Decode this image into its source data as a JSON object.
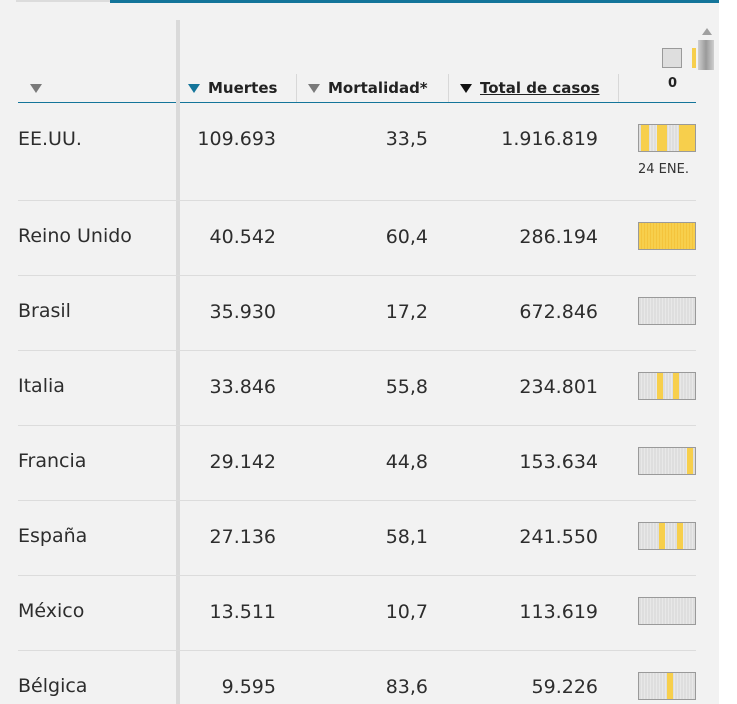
{
  "table": {
    "headers": {
      "country": "",
      "deaths": "Muertes",
      "mortality": "Mortalidad*",
      "cases": "Total de casos"
    },
    "sparkline_axis_label": "0",
    "sparkline_date_label": "24 ENE.",
    "colors": {
      "accent": "#14759a",
      "highlight": "#f7cf4c",
      "background": "#f2f2f2"
    },
    "rows": [
      {
        "country": "EE.UU.",
        "deaths": "109.693",
        "mortality": "33,5",
        "cases": "1.916.819"
      },
      {
        "country": "Reino Unido",
        "deaths": "40.542",
        "mortality": "60,4",
        "cases": "286.194"
      },
      {
        "country": "Brasil",
        "deaths": "35.930",
        "mortality": "17,2",
        "cases": "672.846"
      },
      {
        "country": "Italia",
        "deaths": "33.846",
        "mortality": "55,8",
        "cases": "234.801"
      },
      {
        "country": "Francia",
        "deaths": "29.142",
        "mortality": "44,8",
        "cases": "153.634"
      },
      {
        "country": "España",
        "deaths": "27.136",
        "mortality": "58,1",
        "cases": "241.550"
      },
      {
        "country": "México",
        "deaths": "13.511",
        "mortality": "10,7",
        "cases": "113.619"
      },
      {
        "country": "Bélgica",
        "deaths": "9.595",
        "mortality": "83,6",
        "cases": "59.226"
      }
    ]
  }
}
